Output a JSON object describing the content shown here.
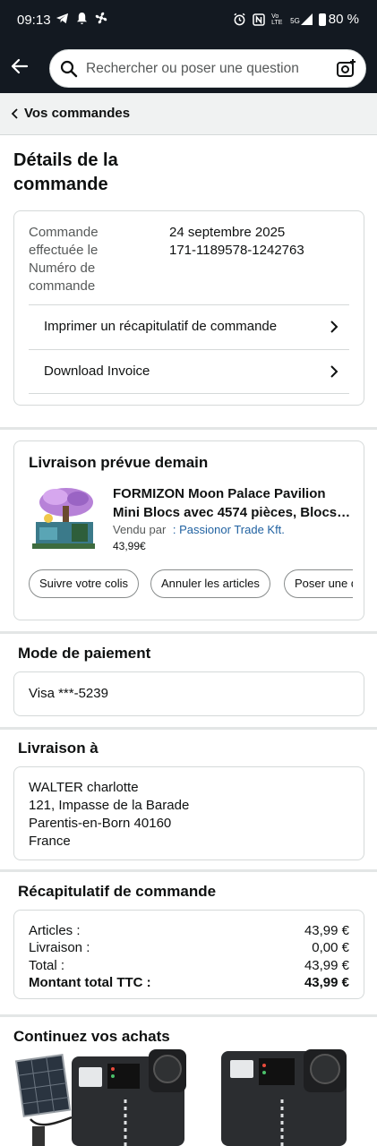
{
  "status_bar": {
    "time": "09:13",
    "left_icons": [
      "telegram-icon",
      "bell-icon",
      "fan-icon"
    ],
    "right_icons": [
      "alarm-icon",
      "nfc-icon",
      "volte-icon",
      "signal-5g-icon"
    ],
    "volte_text": "Vo LTE",
    "network": "5G",
    "battery": "80 %"
  },
  "search": {
    "placeholder": "Rechercher ou poser une question"
  },
  "breadcrumb": {
    "label": "Vos commandes"
  },
  "page": {
    "title_line1": "Détails de la",
    "title_line2": "commande"
  },
  "order": {
    "label_lines": [
      "Commande",
      "effectuée le",
      "Numéro de",
      "commande"
    ],
    "date": "24 septembre 2025",
    "number": "171-1189578-1242763",
    "print_label": "Imprimer un récapitulatif de commande",
    "invoice_label": "Download Invoice"
  },
  "delivery": {
    "heading": "Livraison prévue demain",
    "product_title_line1": "FORMIZON Moon Palace Pavilion",
    "product_title_line2": "Mini Blocs avec 4574 pièces, Blocs…",
    "sold_by_label": "Vendu par",
    "seller": ": Passionor Trade Kft.",
    "price": "43,99€",
    "actions": [
      "Suivre votre colis",
      "Annuler les articles",
      "Poser une question"
    ]
  },
  "payment": {
    "heading": "Mode de paiement",
    "card": "Visa ***-5239"
  },
  "shipping": {
    "heading": "Livraison à",
    "lines": [
      "WALTER charlotte",
      "121, Impasse de la Barade",
      "Parentis-en-Born 40160",
      "France"
    ]
  },
  "summary": {
    "heading": "Récapitulatif de commande",
    "rows": [
      {
        "label": "Articles :",
        "value": "43,99 €"
      },
      {
        "label": "Livraison :",
        "value": "0,00 €"
      },
      {
        "label": "Total :",
        "value": "43,99 €"
      },
      {
        "label": "Montant total TTC :",
        "value": "43,99 €"
      }
    ]
  },
  "continue": {
    "heading": "Continuez vos achats"
  },
  "colors": {
    "header_bg": "#131921",
    "link_blue": "#2162a1",
    "border": "#d5d9d9"
  }
}
